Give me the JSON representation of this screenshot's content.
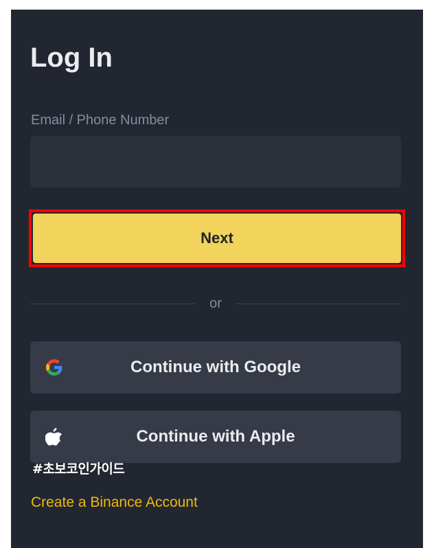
{
  "login": {
    "title": "Log In",
    "email_label": "Email / Phone Number",
    "email_value": "",
    "next_label": "Next",
    "divider_text": "or",
    "google_label": "Continue with Google",
    "apple_label": "Continue with Apple",
    "create_account_label": "Create a Binance Account"
  },
  "watermark": "#초보코인가이드",
  "icons": {
    "google": "google-logo-icon",
    "apple": "apple-logo-icon"
  },
  "colors": {
    "panel_bg": "#222631",
    "input_bg": "#2b3139",
    "primary_yellow": "#f2d35b",
    "highlight_border": "#ff0000",
    "social_bg": "#363b47",
    "link_color": "#f0b90b",
    "label_gray": "#848e9c"
  }
}
